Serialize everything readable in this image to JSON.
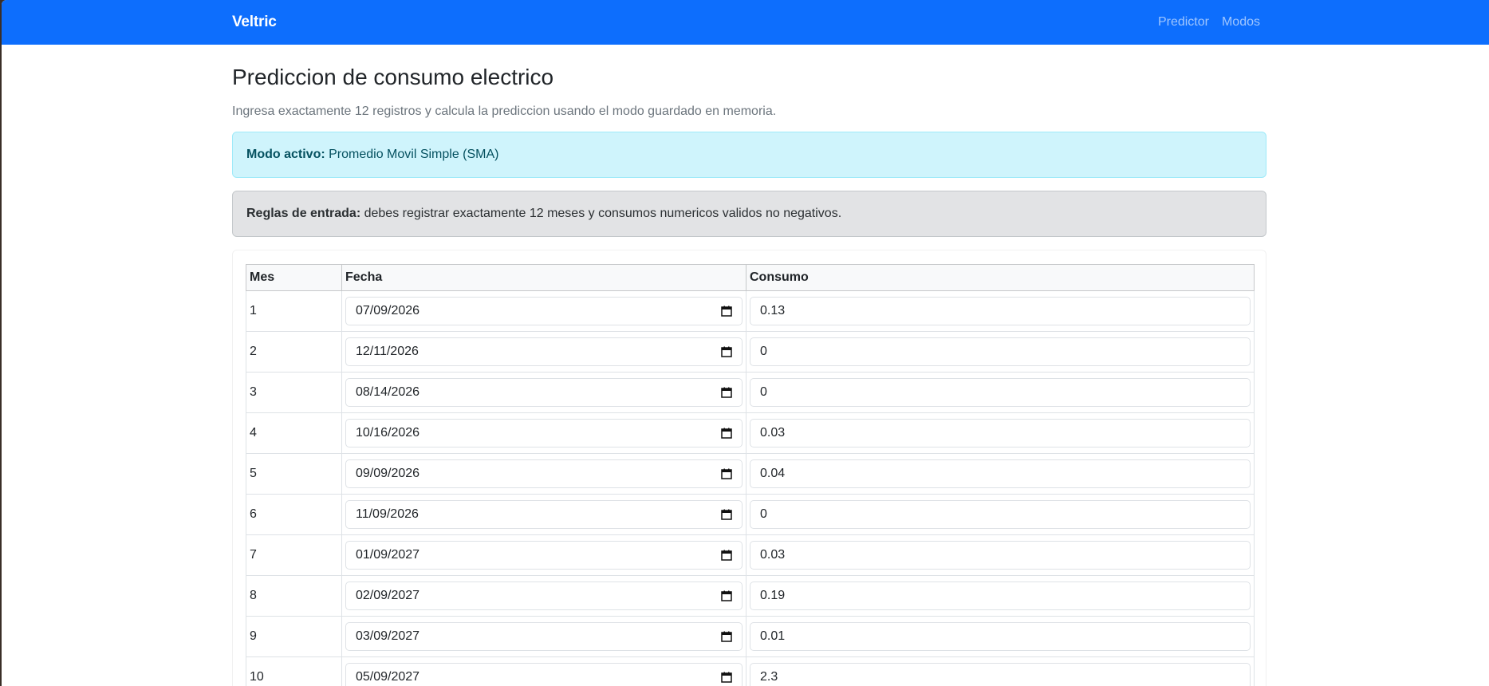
{
  "navbar": {
    "brand": "Veltric",
    "links": [
      "Predictor",
      "Modos"
    ]
  },
  "page": {
    "title": "Prediccion de consumo electrico",
    "subtitle": "Ingresa exactamente 12 registros y calcula la prediccion usando el modo guardado en memoria."
  },
  "mode_alert": {
    "label": "Modo activo:",
    "value": "Promedio Movil Simple (SMA)"
  },
  "rules_alert": {
    "label": "Reglas de entrada:",
    "value": "debes registrar exactamente 12 meses y consumos numericos validos no negativos."
  },
  "table": {
    "headers": [
      "Mes",
      "Fecha",
      "Consumo"
    ],
    "rows": [
      {
        "mes": "1",
        "fecha": "07/09/2026",
        "consumo": "0.13"
      },
      {
        "mes": "2",
        "fecha": "12/11/2026",
        "consumo": "0"
      },
      {
        "mes": "3",
        "fecha": "08/14/2026",
        "consumo": "0"
      },
      {
        "mes": "4",
        "fecha": "10/16/2026",
        "consumo": "0.03"
      },
      {
        "mes": "5",
        "fecha": "09/09/2026",
        "consumo": "0.04"
      },
      {
        "mes": "6",
        "fecha": "11/09/2026",
        "consumo": "0"
      },
      {
        "mes": "7",
        "fecha": "01/09/2027",
        "consumo": "0.03"
      },
      {
        "mes": "8",
        "fecha": "02/09/2027",
        "consumo": "0.19"
      },
      {
        "mes": "9",
        "fecha": "03/09/2027",
        "consumo": "0.01"
      },
      {
        "mes": "10",
        "fecha": "05/09/2027",
        "consumo": "2.3"
      }
    ]
  },
  "colors": {
    "navbar": "#0d6efd",
    "info_bg": "#cff4fc",
    "secondary_bg": "#e2e3e5"
  },
  "icons": {
    "date_picker": "calendar-icon"
  }
}
